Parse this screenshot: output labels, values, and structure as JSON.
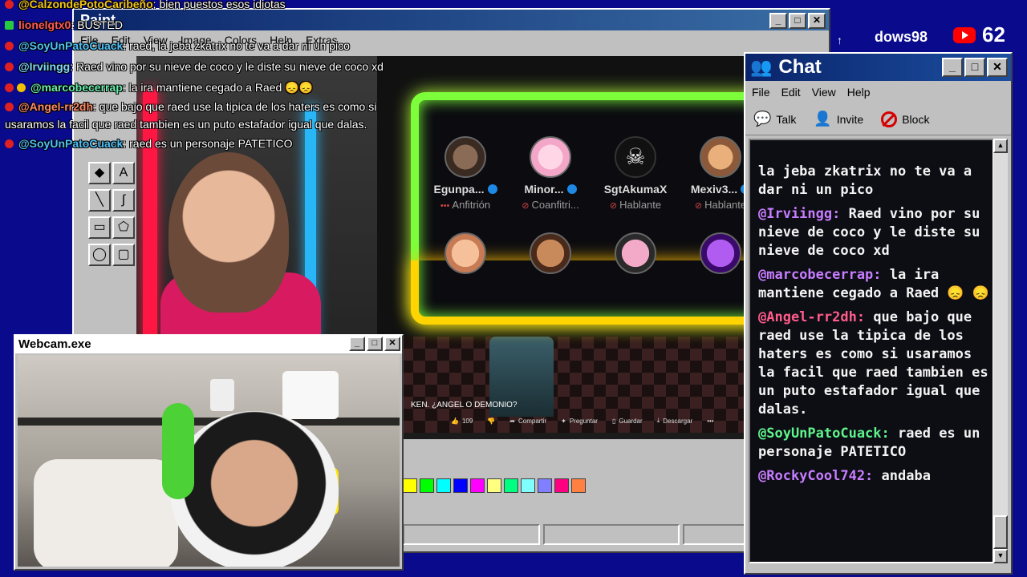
{
  "overlay_chat": [
    {
      "user": "@CalzondePotoCaribeño",
      "text": ": bien puestos esos idiotas",
      "badge": "red"
    },
    {
      "user": "lionelgtx0",
      "text": ": BUSTED",
      "badge": "green"
    },
    {
      "user": "@SoyUnPatoCuack",
      "text": ": raed, la jeba zkatrix no te va a dar ni un pico",
      "badge": "red"
    },
    {
      "user": "@Irviingg",
      "text": ": Raed vino por su nieve de coco y le diste su nieve de coco xd",
      "badge": "red"
    },
    {
      "user": "@marcobecerrap",
      "text": ": la ira mantiene cegado a Raed 😞😞",
      "badge": "red"
    },
    {
      "user": "@Angel-rr2dh",
      "text": ": que bajo que raed use la tipica de los haters es como si usaramos la facil que raed tambien es un puto estafador igual que dalas.",
      "badge": "red"
    },
    {
      "user": "@SoyUnPatoCuack",
      "text": ": raed es un personaje PATETICO",
      "badge": "red"
    }
  ],
  "paint": {
    "title": "Paint",
    "menu": [
      "File",
      "Edit",
      "View",
      "Image",
      "Colors",
      "Help",
      "Extras"
    ],
    "video_caption": "KEN. ¿ANGEL O DEMONIO?",
    "actions": [
      {
        "icon": "like-icon",
        "label": "109"
      },
      {
        "icon": "dislike-icon",
        "label": ""
      },
      {
        "icon": "share-icon",
        "label": "Compartir"
      },
      {
        "icon": "sparkle-icon",
        "label": "Preguntar"
      },
      {
        "icon": "bookmark-icon",
        "label": "Guardar"
      },
      {
        "icon": "download-icon",
        "label": "Descargar"
      }
    ],
    "participants": [
      {
        "name": "Egunpa...",
        "role": "Anfitrión",
        "verified": true
      },
      {
        "name": "Minor...",
        "role": "Coanfitri...",
        "verified": true
      },
      {
        "name": "SgtAkumaX",
        "role": "Hablante",
        "verified": false
      },
      {
        "name": "Mexiv3...",
        "role": "Hablante",
        "verified": true
      }
    ],
    "palette": [
      "#ffff00",
      "#00ff00",
      "#00ffff",
      "#0000ff",
      "#ff00ff",
      "#ffff80",
      "#00ff80",
      "#80ffff",
      "#8080ff",
      "#ff0080",
      "#ff8040"
    ]
  },
  "webcam": {
    "title": "Webcam.exe"
  },
  "chat": {
    "title": "Chat",
    "menu": [
      "File",
      "Edit",
      "View",
      "Help"
    ],
    "toolbar": [
      {
        "icon": "talk-icon",
        "label": "Talk"
      },
      {
        "icon": "invite-icon",
        "label": "Invite"
      },
      {
        "icon": "block-icon",
        "label": "Block"
      }
    ],
    "messages": [
      {
        "user": "",
        "text": "la jeba zkatrix no te va a dar ni un pico"
      },
      {
        "user": "@Irviingg:",
        "text": "Raed vino por su nieve de coco y le diste su nieve de coco xd"
      },
      {
        "user": "@marcobecerrap:",
        "text": "la ira mantiene cegado a Raed 😞 😞"
      },
      {
        "user": "@Angel-rr2dh:",
        "text": "que bajo que raed use la tipica de los haters es como si usaramos la facil que raed tambien es un puto estafador igual que dalas."
      },
      {
        "user": "@SoyUnPatoCuack:",
        "text": "raed es un personaje PATETICO"
      },
      {
        "user": "@RockyCool742:",
        "text": "andaba"
      }
    ]
  },
  "top_right": {
    "windows_text": "dows98",
    "youtube_count": "62"
  }
}
